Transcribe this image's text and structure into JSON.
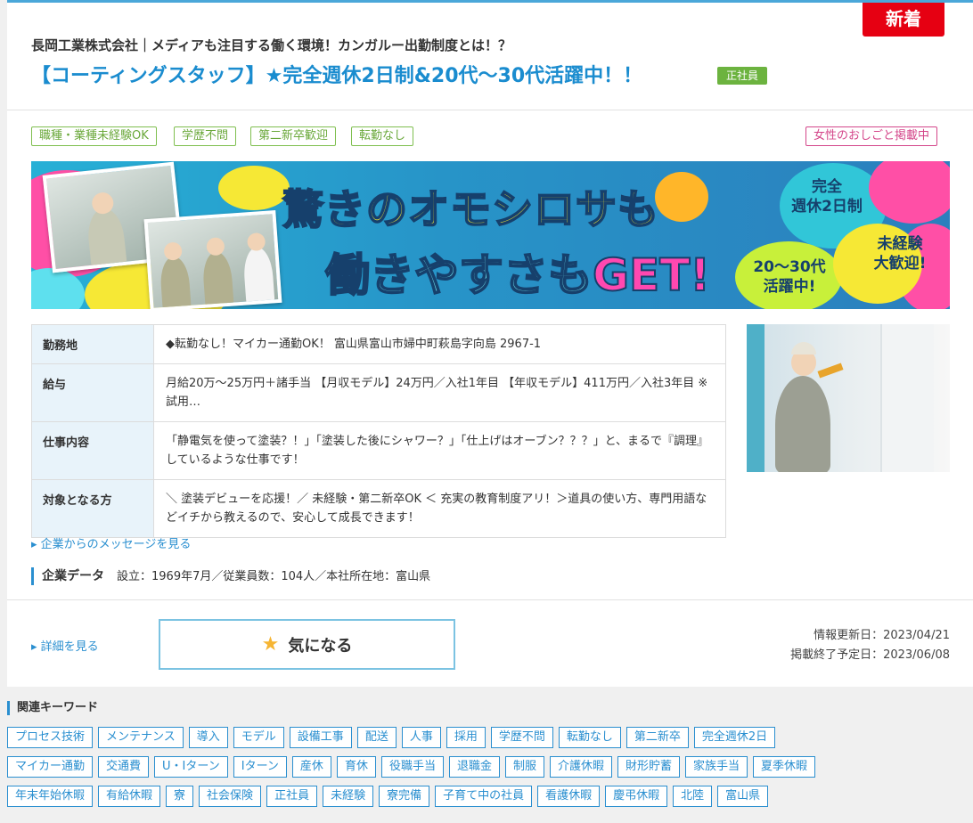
{
  "badge_new": "新着",
  "company_line": "長岡工業株式会社｜メディアも注目する働く環境！カンガルー出勤制度とは！？",
  "job_title": "【コーティングスタッフ】★完全週休2日制&20代〜30代活躍中！！",
  "employment_type": "正社員",
  "tags": [
    "職種・業種未経験OK",
    "学歴不問",
    "第二新卒歓迎",
    "転勤なし"
  ],
  "tag_women": "女性のおしごと掲載中",
  "banner": {
    "line1": "驚きのオモシロサも",
    "line2_a": "働きやすさも",
    "line2_b": "GET!",
    "bubble1": "完全\n週休2日制",
    "bubble2": "未経験\n大歓迎!",
    "bubble3": "20〜30代\n活躍中!"
  },
  "info": [
    {
      "label": "勤務地",
      "value": "◆転勤なし！マイカー通勤OK！ 富山県富山市婦中町萩島字向島 2967-1"
    },
    {
      "label": "給与",
      "value": "月給20万〜25万円＋諸手当 【月収モデル】24万円／入社1年目 【年収モデル】411万円／入社3年目 ※試用…"
    },
    {
      "label": "仕事内容",
      "value": "「静電気を使って塗装？！」「塗装した後にシャワー？」「仕上げはオーブン？？？」と、まるで『調理』しているような仕事です！"
    },
    {
      "label": "対象となる方",
      "value": "＼ 塗装デビューを応援！／ 未経験・第二新卒OK ＜ 充実の教育制度アリ！＞道具の使い方、専門用語などイチから教えるので、安心して成長できます！"
    }
  ],
  "message_link": "▸ 企業からのメッセージを見る",
  "company_data_label": "企業データ",
  "company_data_value": "設立：1969年7月／従業員数：104人／本社所在地：富山県",
  "detail_link": "▸ 詳細を見る",
  "fav_label": "気になる",
  "updated": "情報更新日：2023/04/21",
  "end_date": "掲載終了予定日：2023/06/08",
  "keywords_title": "関連キーワード",
  "keywords": [
    "プロセス技術",
    "メンテナンス",
    "導入",
    "モデル",
    "設備工事",
    "配送",
    "人事",
    "採用",
    "学歴不問",
    "転勤なし",
    "第二新卒",
    "完全週休2日",
    "マイカー通勤",
    "交通費",
    "U・Iターン",
    "Iターン",
    "産休",
    "育休",
    "役職手当",
    "退職金",
    "制服",
    "介護休暇",
    "財形貯蓄",
    "家族手当",
    "夏季休暇",
    "年末年始休暇",
    "有給休暇",
    "寮",
    "社会保険",
    "正社員",
    "未経験",
    "寮完備",
    "子育て中の社員",
    "看護休暇",
    "慶弔休暇",
    "北陸",
    "富山県"
  ],
  "colors": {
    "accent": "#2a8fd0",
    "new": "#e60012",
    "green": "#6cb33f",
    "pink": "#d4468a"
  }
}
